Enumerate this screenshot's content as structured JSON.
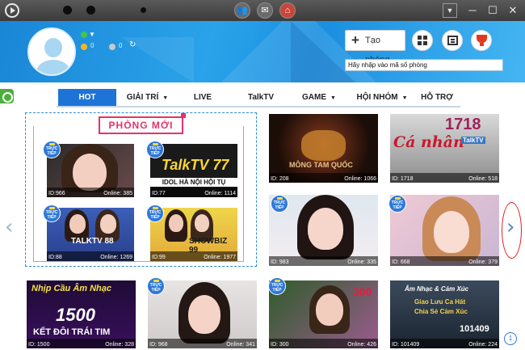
{
  "header": {
    "coins_gold": "0",
    "coins_silver": "0",
    "create_room_label": "Tạo phòng",
    "search_placeholder": "Hãy nhập vào mã số phòng"
  },
  "nav": {
    "items": [
      {
        "label": "HOT"
      },
      {
        "label": "GIẢI TRÍ"
      },
      {
        "label": "LIVE"
      },
      {
        "label": "TalkTV"
      },
      {
        "label": "GAME"
      },
      {
        "label": "HỘI NHÓM"
      },
      {
        "label": "HỖ TRỢ"
      }
    ]
  },
  "new_rooms": {
    "title": "PHÒNG MỚI",
    "live_label": "TRỰC TIẾP",
    "rooms": [
      {
        "id": "ID:966",
        "online": "Online: 385"
      },
      {
        "id": "ID:77",
        "online": "Online: 1114",
        "art": "TalkTV 77",
        "sub": "IDOL HÀ NỘI HỘI TỤ"
      },
      {
        "id": "ID:88",
        "online": "Online: 1269",
        "art": "TALKTV 88"
      },
      {
        "id": "ID:99",
        "online": "Online: 1977",
        "art": "SHOWBIZ 99"
      }
    ]
  },
  "grid": {
    "rooms": [
      {
        "id": "ID: 208",
        "online": "Online: 1066",
        "art": "MÔNG TAM QUỐC"
      },
      {
        "id": "ID: 1718",
        "online": "Online: 518",
        "art": "1718",
        "art2": "Cá nhân",
        "art3": "TalkTV"
      },
      {
        "id": "ID: 983",
        "online": "Online: 335"
      },
      {
        "id": "ID: 668",
        "online": "Online: 379"
      },
      {
        "id": "ID: 1500",
        "online": "Online: 328",
        "art": "Nhịp Cầu Âm Nhạc",
        "art2": "1500",
        "art3": "KẾT ĐÔI TRÁI TIM"
      },
      {
        "id": "ID: 968",
        "online": "Online: 341"
      },
      {
        "id": "ID: 300",
        "online": "Online: 426",
        "art": "300"
      },
      {
        "id": "ID: 101409",
        "online": "Online: 224",
        "art": "Âm Nhạc & Cảm Xúc",
        "art2": "Giao Lưu Ca Hát",
        "art3": "Chia Sẻ Cảm Xúc",
        "art4": "101409"
      }
    ]
  },
  "pagination": {
    "current": "1"
  },
  "colors": {
    "accent": "#1e73d6",
    "new_rooms": "#e5326b",
    "live_badge": "#2f78d6"
  }
}
